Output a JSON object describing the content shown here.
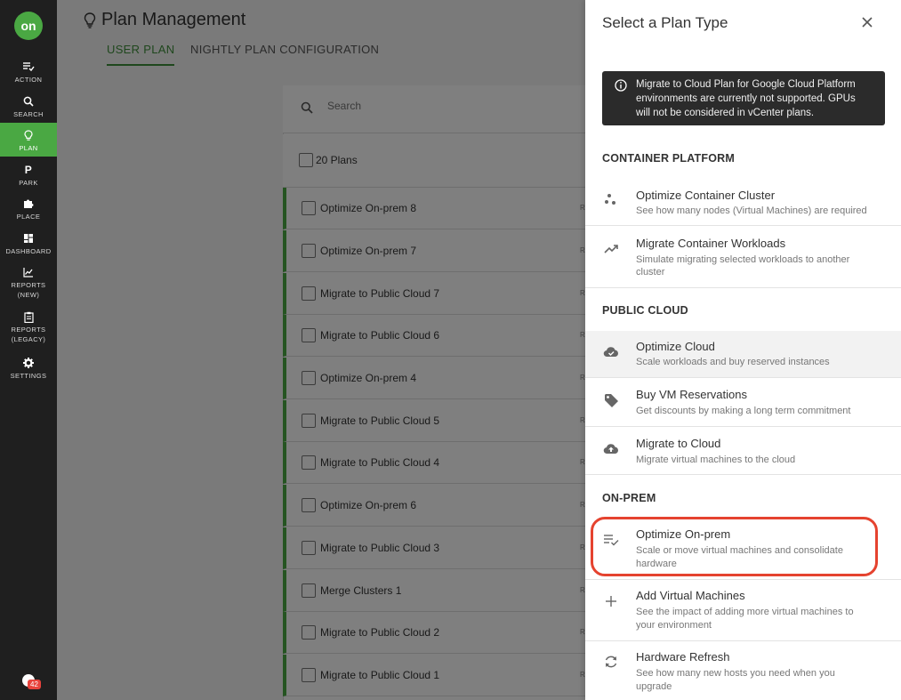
{
  "nav": {
    "logo": "on",
    "items": [
      {
        "label": "ACTION",
        "label2": "",
        "icon": "action-icon"
      },
      {
        "label": "SEARCH",
        "label2": "",
        "icon": "search-icon"
      },
      {
        "label": "PLAN",
        "label2": "",
        "icon": "lightbulb-icon"
      },
      {
        "label": "PARK",
        "label2": "",
        "icon": "park-icon"
      },
      {
        "label": "PLACE",
        "label2": "",
        "icon": "puzzle-icon"
      },
      {
        "label": "DASHBOARD",
        "label2": "",
        "icon": "dashboard-icon"
      },
      {
        "label": "REPORTS",
        "label2": "(NEW)",
        "icon": "chart-icon"
      },
      {
        "label": "REPORTS",
        "label2": "(LEGACY)",
        "icon": "clipboard-icon"
      },
      {
        "label": "SETTINGS",
        "label2": "",
        "icon": "gear-icon"
      }
    ],
    "notification_count": "42"
  },
  "header": {
    "title": "Plan Management",
    "tabs": [
      "USER PLAN",
      "NIGHTLY PLAN CONFIGURATION"
    ]
  },
  "list": {
    "search_placeholder": "Search",
    "count_label": "20 Plans",
    "row_tag": "RA",
    "plans": [
      "Optimize On-prem 8",
      "Optimize On-prem 7",
      "Migrate to Public Cloud 7",
      "Migrate to Public Cloud 6",
      "Optimize On-prem 4",
      "Migrate to Public Cloud 5",
      "Migrate to Public Cloud 4",
      "Optimize On-prem 6",
      "Migrate to Public Cloud 3",
      "Merge Clusters 1",
      "Migrate to Public Cloud 2",
      "Migrate to Public Cloud 1"
    ]
  },
  "panel": {
    "title": "Select a Plan Type",
    "notice_lines": [
      "Migrate to Cloud Plan for Google Cloud Platform",
      "environments are currently not supported. GPUs",
      "will not be considered in vCenter plans."
    ],
    "sections": {
      "container": "CONTAINER PLATFORM",
      "public": "PUBLIC CLOUD",
      "onprem": "ON-PREM"
    },
    "options": {
      "occ": {
        "title": "Optimize Container Cluster",
        "desc": [
          "See how many nodes (Virtual Machines) are required"
        ]
      },
      "mcw": {
        "title": "Migrate Container Workloads",
        "desc": [
          "Simulate migrating selected workloads to another",
          "cluster"
        ]
      },
      "oc": {
        "title": "Optimize Cloud",
        "desc": [
          "Scale workloads and buy reserved instances"
        ]
      },
      "bvr": {
        "title": "Buy VM Reservations",
        "desc": [
          "Get discounts by making a long term commitment"
        ]
      },
      "mtc": {
        "title": "Migrate to Cloud",
        "desc": [
          "Migrate virtual machines to the cloud"
        ]
      },
      "oop": {
        "title": "Optimize On-prem",
        "desc": [
          "Scale or move virtual machines and consolidate",
          "hardware"
        ]
      },
      "avm": {
        "title": "Add Virtual Machines",
        "desc": [
          "See the impact of adding more virtual machines to",
          "your environment"
        ]
      },
      "hr": {
        "title": "Hardware Refresh",
        "desc": [
          "See how many new hosts you need when you",
          "upgrade"
        ]
      }
    }
  },
  "colors": {
    "accent": "#4aa843",
    "highlight": "#e5432f",
    "nav_bg": "#1f1f1f"
  }
}
